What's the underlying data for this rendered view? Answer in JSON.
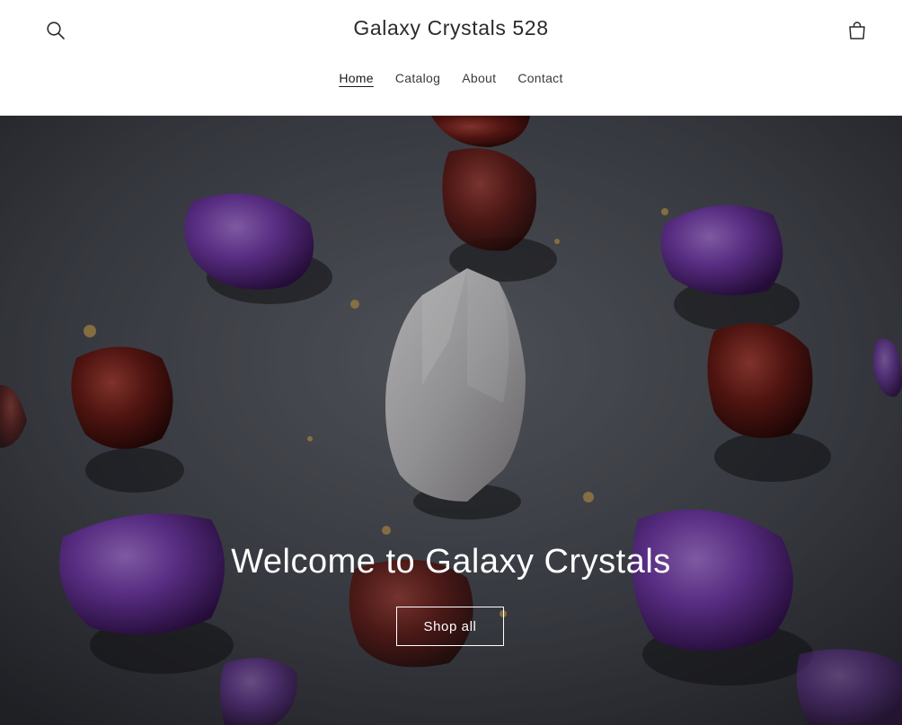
{
  "header": {
    "site_title": "Galaxy Crystals 528",
    "search_icon": "search-icon",
    "cart_icon": "cart-icon"
  },
  "nav": {
    "items": [
      {
        "label": "Home",
        "active": true
      },
      {
        "label": "Catalog",
        "active": false
      },
      {
        "label": "About",
        "active": false
      },
      {
        "label": "Contact",
        "active": false
      }
    ]
  },
  "hero": {
    "heading": "Welcome to Galaxy Crystals",
    "button_label": "Shop all",
    "image_subject": "tumbled amethyst, red jasper and clear quartz crystals on slate surface"
  },
  "colors": {
    "text": "#1f1f1f",
    "hero_text": "#ffffff",
    "amethyst": "#7a3fb5",
    "jasper": "#7a1f1a",
    "slate": "#3a3c44"
  }
}
